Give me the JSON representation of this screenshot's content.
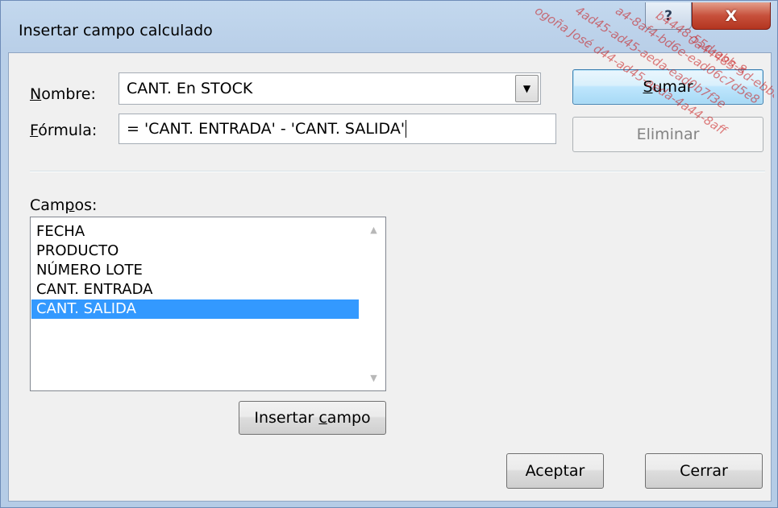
{
  "window": {
    "title": "Insertar campo calculado",
    "help_label": "?",
    "close_label": "X"
  },
  "form": {
    "nombre_label_mnemonic": "N",
    "nombre_label_rest": "ombre:",
    "nombre_value": "CANT. En STOCK",
    "formula_label_mnemonic": "F",
    "formula_label_rest": "órmula:",
    "formula_value": "= 'CANT. ENTRADA' - 'CANT. SALIDA'"
  },
  "buttons": {
    "sumar_mnemonic": "S",
    "sumar_rest": "umar",
    "eliminar": "Eliminar",
    "insertar_campo_prefix": "Insertar ",
    "insertar_campo_mnemonic": "c",
    "insertar_campo_rest": "ampo",
    "aceptar": "Aceptar",
    "cerrar": "Cerrar"
  },
  "campos": {
    "label_prefix": "Cam",
    "label_mnemonic": "p",
    "label_rest": "os:",
    "items": [
      "FECHA",
      "PRODUCTO",
      "NÚMERO LOTE",
      "CANT. ENTRADA",
      "CANT. SALIDA"
    ],
    "selected_index": 4
  },
  "watermark": {
    "lines": [
      "ogoña José  d44-ad45-aeda-4a44-8aff",
      "4ad45-ad45-aeda-ead0b7f3e",
      "a4-8af4-bd6e-ead06c7d5e8",
      "b4448-55d-ebb-8",
      "0a44485-5d-ebb8"
    ]
  },
  "colors": {
    "title_bar": "#b9cfe8",
    "client": "#f0f0f0",
    "selection": "#3399ff",
    "close_button": "#c7503b",
    "default_button_border": "#3c7fb1"
  }
}
